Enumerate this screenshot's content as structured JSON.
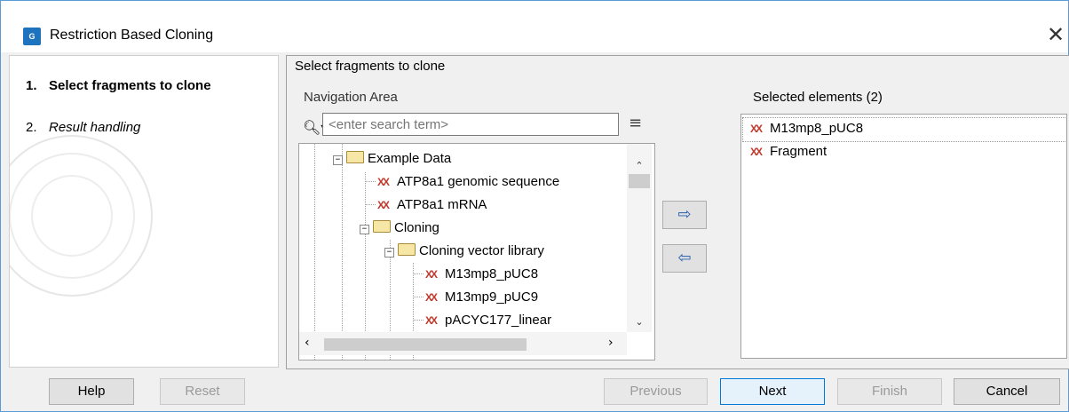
{
  "window": {
    "title": "Restriction Based Cloning",
    "app_icon_text": "G"
  },
  "steps": [
    {
      "num": "1.",
      "label": "Select fragments to clone"
    },
    {
      "num": "2.",
      "label": "Result handling"
    }
  ],
  "panel": {
    "title": "Select fragments to clone",
    "navigation_label": "Navigation Area",
    "search_placeholder": "<enter search term>",
    "selected_label": "Selected elements (2)"
  },
  "tree": [
    {
      "label": "Example Data",
      "type": "folder",
      "expanded": true
    },
    {
      "label": "ATP8a1 genomic sequence",
      "type": "sequence"
    },
    {
      "label": "ATP8a1 mRNA",
      "type": "sequence"
    },
    {
      "label": "Cloning",
      "type": "folder",
      "expanded": true
    },
    {
      "label": "Cloning vector library",
      "type": "folder",
      "expanded": true
    },
    {
      "label": "M13mp8_pUC8",
      "type": "sequence"
    },
    {
      "label": "M13mp9_pUC9",
      "type": "sequence"
    },
    {
      "label": "pACYC177_linear",
      "type": "sequence"
    }
  ],
  "selected": [
    {
      "label": "M13mp8_pUC8"
    },
    {
      "label": "Fragment"
    }
  ],
  "icons": {
    "sequence_glyph": "XX",
    "add_arrow": "⇨",
    "remove_arrow": "⇦"
  },
  "buttons": {
    "help": "Help",
    "reset": "Reset",
    "previous": "Previous",
    "next": "Next",
    "finish": "Finish",
    "cancel": "Cancel"
  },
  "colors": {
    "sequence_icon": "#c0392b",
    "accent": "#0078d7"
  }
}
